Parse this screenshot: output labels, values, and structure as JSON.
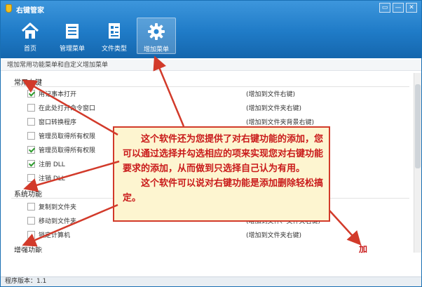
{
  "window": {
    "title": "右键管家",
    "controls": [
      "▭",
      "—",
      "✕"
    ]
  },
  "nav": {
    "items": [
      {
        "label": "首页",
        "icon": "home-icon"
      },
      {
        "label": "管理菜单",
        "icon": "list-icon"
      },
      {
        "label": "文件类型",
        "icon": "file-type-icon"
      },
      {
        "label": "增加菜单",
        "icon": "gear-icon",
        "active": true
      }
    ]
  },
  "subheader": "增加常用功能菜单和自定义增加菜单",
  "groups": [
    {
      "title": "常用右键",
      "items": [
        {
          "label": "用记事本打开",
          "note": "(增加到文件右键)",
          "checked": true
        },
        {
          "label": "在此处打开命令窗口",
          "note": "(增加到文件夹右键)",
          "checked": false
        },
        {
          "label": "窗口转换程序",
          "note": "(增加到文件夹背景右键)",
          "checked": false
        },
        {
          "label": "管理员取得所有权限",
          "note": "",
          "checked": false
        },
        {
          "label": "管理员取得所有权限",
          "note": "",
          "checked": true
        },
        {
          "label": "注册 DLL",
          "note": "",
          "checked": true
        },
        {
          "label": "注销 DLL",
          "note": "",
          "checked": false
        }
      ]
    },
    {
      "title": "系统功能",
      "items": [
        {
          "label": "复制到文件夹",
          "note": "",
          "checked": false
        },
        {
          "label": "移动到文件夹",
          "note": "(增加到文件、文件夹右键)",
          "checked": false
        },
        {
          "label": "锁定计算机",
          "note": "(增加到文件夹右键)",
          "checked": false
        }
      ]
    },
    {
      "title": "增强功能",
      "items": []
    }
  ],
  "statusbar": "程序版本：1.1",
  "callout": {
    "paragraph1": "这个软件还为您提供了对右键功能的添加，您可以通过选择并勾选相应的项来实现您对右键功能要求的添加，从而做到只选择自己认为有用。",
    "paragraph2": "这个软件可以说对右键功能是添加删除轻松搞定。"
  },
  "watermark": "加",
  "colors": {
    "header_blue": "#1f7bc7",
    "callout_border": "#d23a2a",
    "callout_text": "#c91a1a",
    "callout_bg": "#fdf5d0"
  }
}
